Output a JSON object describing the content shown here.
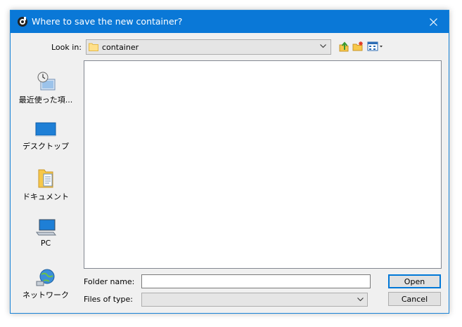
{
  "dialog": {
    "title": "Where to save the new container?",
    "colors": {
      "titlebar": "#0a78d7",
      "accent": "#0078d7"
    }
  },
  "lookin": {
    "label": "Look in:",
    "value": "container"
  },
  "toolbar": {
    "icons": [
      "up-one-level-icon",
      "new-folder-icon",
      "view-menu-icon"
    ]
  },
  "places": [
    {
      "label": "最近使った項...",
      "icon": "recent-places-icon"
    },
    {
      "label": "デスクトップ",
      "icon": "desktop-icon"
    },
    {
      "label": "ドキュメント",
      "icon": "documents-icon"
    },
    {
      "label": "PC",
      "icon": "computer-icon"
    },
    {
      "label": "ネットワーク",
      "icon": "network-icon"
    }
  ],
  "form": {
    "folder_name_label": "Folder name:",
    "folder_name_value": "",
    "files_of_type_label": "Files of type:",
    "files_of_type_value": ""
  },
  "buttons": {
    "open": "Open",
    "cancel": "Cancel"
  }
}
